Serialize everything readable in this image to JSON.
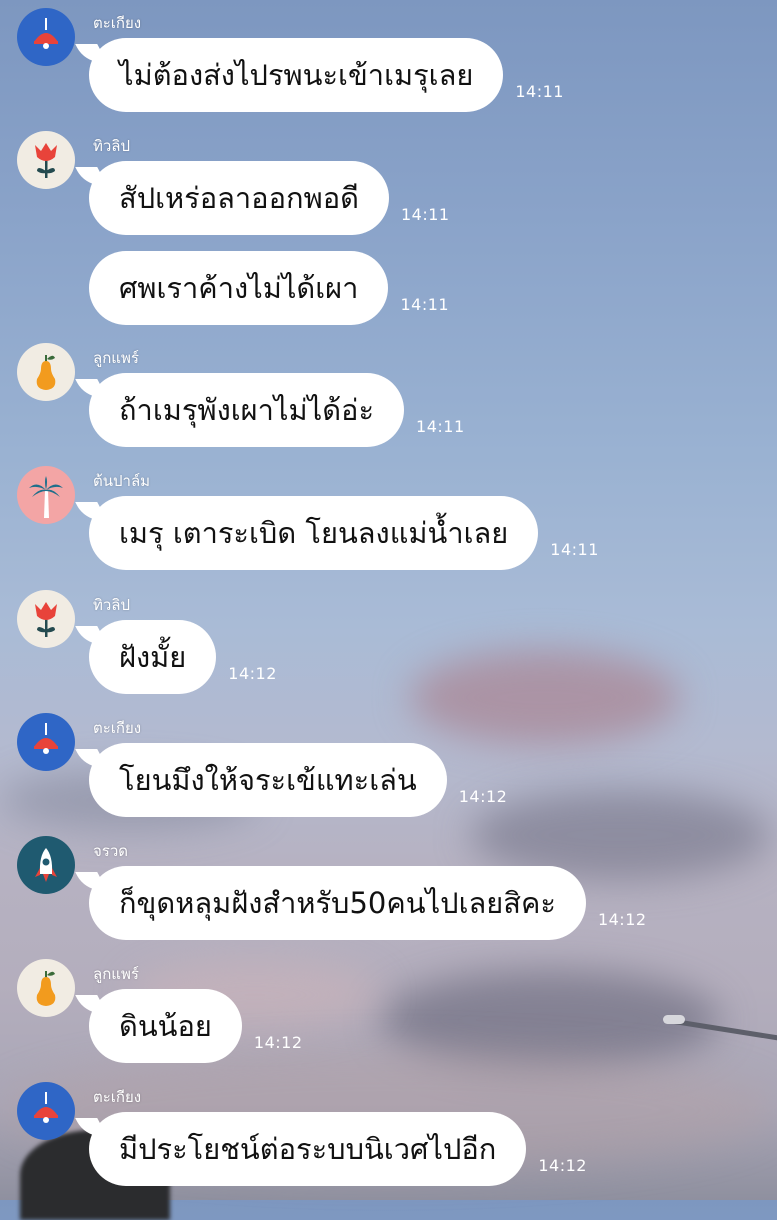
{
  "chat": {
    "messages": [
      {
        "sender": "ตะเกียง",
        "avatar": "lamp-icon",
        "text": "ไม่ต้องส่งไปรพนะเข้าเมรุเลย",
        "time": "14:11"
      },
      {
        "sender": "ทิวลิป",
        "avatar": "tulip-icon",
        "text": "สัปเหร่อลาออกพอดี",
        "time": "14:11"
      },
      {
        "text": "ศพเราค้างไม่ได้เผา",
        "time": "14:11"
      },
      {
        "sender": "ลูกแพร์",
        "avatar": "pear-icon",
        "text": "ถ้าเมรุพังเผาไม่ได้อ่ะ",
        "time": "14:11"
      },
      {
        "sender": "ต้นปาล์ม",
        "avatar": "palm-tree-icon",
        "text": "เมรุ เตาระเบิด โยนลงแม่น้ำเลย",
        "time": "14:11"
      },
      {
        "sender": "ทิวลิป",
        "avatar": "tulip-icon",
        "text": "ฝังมั้ย",
        "time": "14:12"
      },
      {
        "sender": "ตะเกียง",
        "avatar": "lamp-icon",
        "text": "โยนมึงให้จระเข้แทะเล่น",
        "time": "14:12"
      },
      {
        "sender": "จรวด",
        "avatar": "rocket-icon",
        "text": "ก็ขุดหลุมฝังสำหรับ50คนไปเลยสิคะ",
        "time": "14:12"
      },
      {
        "sender": "ลูกแพร์",
        "avatar": "pear-icon",
        "text": "ดินน้อย",
        "time": "14:12"
      },
      {
        "sender": "ตะเกียง",
        "avatar": "lamp-icon",
        "text": "มีประโยชน์ต่อระบบนิเวศไปอีก",
        "time": "14:12"
      }
    ]
  },
  "colors": {
    "bubble": "#ffffff",
    "lamp_avatar_bg": "#2f66c6",
    "tulip_avatar_bg": "#f1ece3",
    "pear_avatar_bg": "#f1ece3",
    "palm_avatar_bg": "#f3a5a5",
    "rocket_avatar_bg": "#1f5a70"
  }
}
